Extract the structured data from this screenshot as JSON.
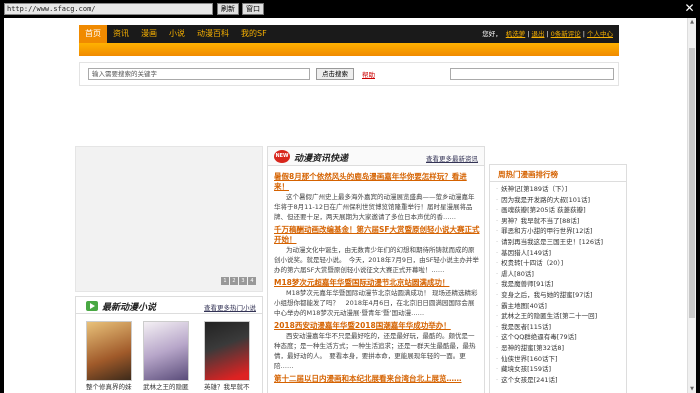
{
  "browser": {
    "url": "http://www.sfacg.com/",
    "refresh_label": "刷新",
    "window_label": "窗口",
    "close_glyph": "✕"
  },
  "nav": {
    "items": [
      "首页",
      "资讯",
      "漫画",
      "小说",
      "动漫百科",
      "我的SF"
    ],
    "active_index": 0,
    "greeting": "您好，",
    "username": "机洗萝",
    "logout": "退出",
    "points": "0条新评论",
    "my_center": "个人中心",
    "accent_color": "#f08a00"
  },
  "search": {
    "placeholder": "输入需要搜索的关键字",
    "button_label": "点击搜索",
    "help_link": "帮助"
  },
  "slider": {
    "dots": [
      "1",
      "2",
      "3",
      "4"
    ]
  },
  "novels": {
    "title": "最新动漫小说",
    "more_link": "查看更多热门小说",
    "books": [
      {
        "caption": "整个修真界的妹子都想…"
      },
      {
        "caption": "武林之王的隐匿生活"
      },
      {
        "caption": "英雄？我早就不当了"
      }
    ]
  },
  "news": {
    "badge": "NEW",
    "title": "动漫资讯快递",
    "more_link": "查看更多最新资讯",
    "articles": [
      {
        "title": "暑假8月那个依然风头的鹿岛漫画嘉年华你要怎样玩？看进来！",
        "text": "这个暑假广州史上最多海外嘉宾的动漫展览盛典——萤乡动漫嘉年华将于8月11-12日在广州保利世贸博览馆隆重举行！届时星漫展将品牌、但还要十足，两天展期为大家邀请了多位日本声优的香……"
      },
      {
        "title": "千万稿酬动画改编基金！第六届SF大赏暨原创轻小说大赛正式开始！",
        "text": "为动漫文化中诞生，由无数青少年们的幻想和期待所铸就而成的原创小说奖。就是轻小说。　今天，2018年7月9日，由SF轻小说主办并举办的第六届SF大赏暨原创轻小说征文大赛正式开幕啦！……"
      },
      {
        "title": "M18梦次元超嘉年华暨国际动漫节北京站圆满成功！",
        "text": "M18梦次元嘉年华暨国际动漫节北京站圆满成功！ 现场还精选精彩小组想你都能发了吗？　2018年4月6日，在北京旧日圆满园国际会展中心举办的M18梦次元动漫展·暨青年‘暨’国动漫……"
      },
      {
        "title": "2018西安动漫嘉年华暨2018国潮嘉年华成功举办！",
        "text": "西安动漫嘉年华不只是最好吃的，还是最好玩，最酷的。颇优是一种态度；是一种生活方式；一种生活追求；还是一群天生最酷最，最热情，最好动的人。　要看本身，要拼本命，更能展现年轻的一面。更陪……"
      },
      {
        "title": "第十二届以日内漫画和本纪北展看来台湾台北上展览……",
        "text": ""
      }
    ]
  },
  "rank": {
    "title": "周热门漫画排行榜",
    "items": [
      "妖神记[第189话（下）]",
      "因为我是开发路的大叔[101话]",
      "画魂荻瓣[第205话 荻菱荻瓣]",
      "男神？我早就不当了[88话]",
      "罪恶和方小甜的甲行世界[12话]",
      "请别再当我这是三国王史！[126话]",
      "基因猎人[149话]",
      "权贵转[十四话（20）]",
      "虐人[80话]",
      "我是魔兽师[91话]",
      "变身之后，我与她的甜蜜[97话]",
      "霸主地图[40话]",
      "武林之王的隐匿生活[第二十一回]",
      "我是医者[115话]",
      "这个QQ群绝逼有毒[79话]",
      "恶神的甜蜜[第32话8]",
      "仙侠世界[160话下]",
      "藏境女孩[159话]",
      "这个女孩是[241话]"
    ]
  }
}
